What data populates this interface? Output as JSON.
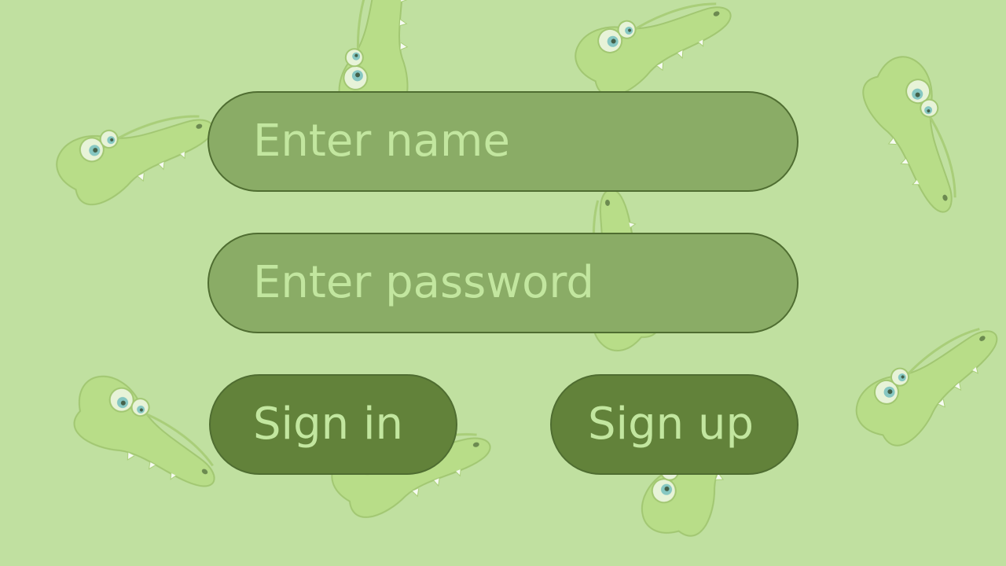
{
  "login": {
    "name_placeholder": "Enter name",
    "password_placeholder": "Enter password",
    "sign_in_label": "Sign in",
    "sign_up_label": "Sign up"
  },
  "background": {
    "pattern_icon": "crocodile-icon"
  },
  "colors": {
    "background": "#c0e0a0",
    "field_fill": "#8aac66",
    "button_fill": "#62823a",
    "border": "#4f6d31",
    "text": "#c2e69f"
  }
}
